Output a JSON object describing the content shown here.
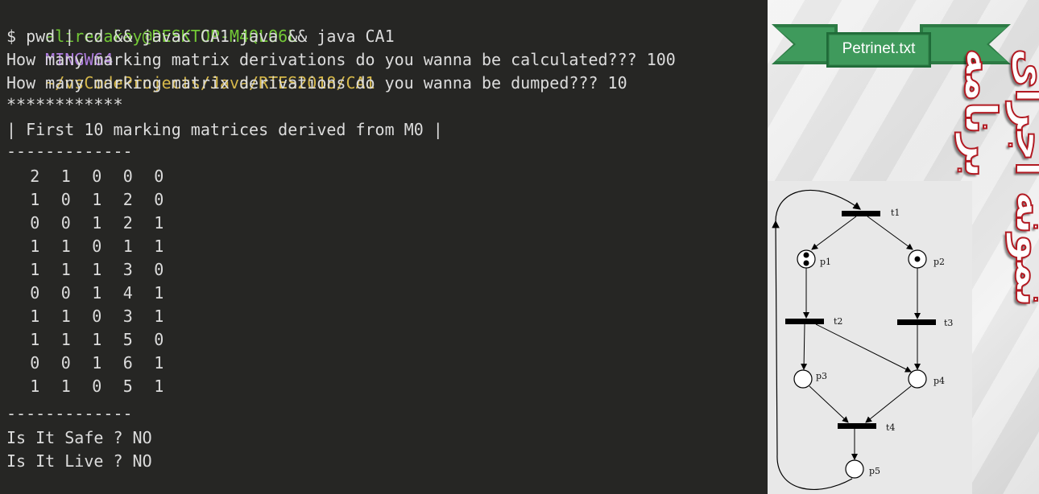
{
  "terminal": {
    "prompt_user": "alirezakay@DESKTOP-M4QLO6L",
    "prompt_system": "MINGW64",
    "prompt_path": "~/vsCodeProjects/Java/RTES2018/CA1",
    "command": "$ pwd | cd && javac CA1.java && java CA1",
    "question_calculated": "How many marking matrix derivations do you wanna be calculated??? 100",
    "question_dumped": "How many marking matrix derivations do you wanna be dumped??? 10",
    "stars": "************",
    "header": "| First 10 marking matrices derived from M0 |",
    "separator_top": "-------------",
    "matrices": [
      [
        "2",
        "1",
        "0",
        "0",
        "0"
      ],
      [
        "1",
        "0",
        "1",
        "2",
        "0"
      ],
      [
        "0",
        "0",
        "1",
        "2",
        "1"
      ],
      [
        "1",
        "1",
        "0",
        "1",
        "1"
      ],
      [
        "1",
        "1",
        "1",
        "3",
        "0"
      ],
      [
        "0",
        "0",
        "1",
        "4",
        "1"
      ],
      [
        "1",
        "1",
        "0",
        "3",
        "1"
      ],
      [
        "1",
        "1",
        "1",
        "5",
        "0"
      ],
      [
        "0",
        "0",
        "1",
        "6",
        "1"
      ],
      [
        "1",
        "1",
        "0",
        "5",
        "1"
      ]
    ],
    "separator_bottom": "-------------",
    "safe_line": "Is It Safe ? NO",
    "live_line": "Is It Live ? NO"
  },
  "slide": {
    "banner_label": "Petrinet.txt",
    "persian_title": "نمونه اجرای برنامه",
    "colors": {
      "banner_green": "#3f9a5c",
      "banner_dark": "#2c7a44",
      "title_red": "#b21a22"
    },
    "petri_net": {
      "places": [
        "p1",
        "p2",
        "p3",
        "p4",
        "p5"
      ],
      "transitions": [
        "t1",
        "t2",
        "t3",
        "t4"
      ],
      "initial_tokens": {
        "p1": 2,
        "p2": 1,
        "p3": 0,
        "p4": 0,
        "p5": 0
      }
    }
  }
}
